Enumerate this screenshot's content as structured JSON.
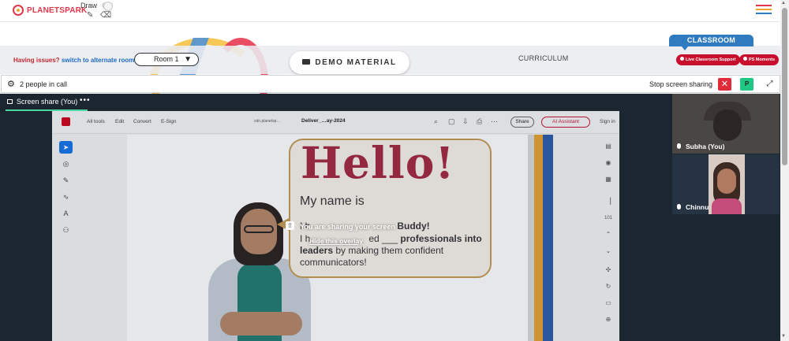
{
  "app": {
    "brand": "PLANETSPARK",
    "draw_label": "Draw",
    "draw_enabled": false,
    "icons": [
      "pencil-icon",
      "eraser-icon",
      "hamburger-menu-icon"
    ],
    "hamburger_colors": [
      "#e2364a",
      "#f2a42a",
      "#2f7bbf"
    ]
  },
  "room_bar": {
    "issues_text": "Having issues?",
    "alt_room_link": "switch to alternate room",
    "room_select": "Room 1",
    "demo_material": "DEMO MATERIAL",
    "curriculum": "CURRICULUM",
    "classroom_tab": "CLASSROOM",
    "live_support": "Live Classroom Support",
    "ps_moments": "PS Moments"
  },
  "call": {
    "people_count": "2 people in call",
    "stop_sharing": "Stop screen sharing",
    "close_symbol": "✕",
    "participant_initial": "P",
    "expand_symbol": "⤢"
  },
  "share": {
    "tab_label": "Screen share (You)",
    "tab_menu": "•••",
    "overlay_text": "You are sharing your screen",
    "overlay_hide": "Hide this overlay"
  },
  "acrobat": {
    "menu": [
      "All tools",
      "Edit",
      "Convert",
      "E-Sign"
    ],
    "doc_host": "cdn.planetsp…",
    "doc_file": "Deliver_…ay-2024",
    "share_button": "Share",
    "ai_button": "AI Assistant",
    "sign_in": "Sign in",
    "page_number": "101"
  },
  "slide": {
    "hello": "Hello!",
    "my_name": "My name is",
    "line2_a": "I h",
    "line2_b": "Buddy!",
    "line3_a": "I h",
    "line3_b": "ed ___ ",
    "line3_c": "professionals into",
    "line4_a": "leaders",
    "line4_b": " by making them confident",
    "line5": "communicators!"
  },
  "participants": [
    {
      "name": "Subha (You)"
    },
    {
      "name": "Chinnu"
    }
  ],
  "colors": {
    "accent_red": "#c8102e",
    "classroom_blue": "#2f7bbf",
    "share_green": "#4bd6a1",
    "stage_bg": "#1c2631"
  }
}
